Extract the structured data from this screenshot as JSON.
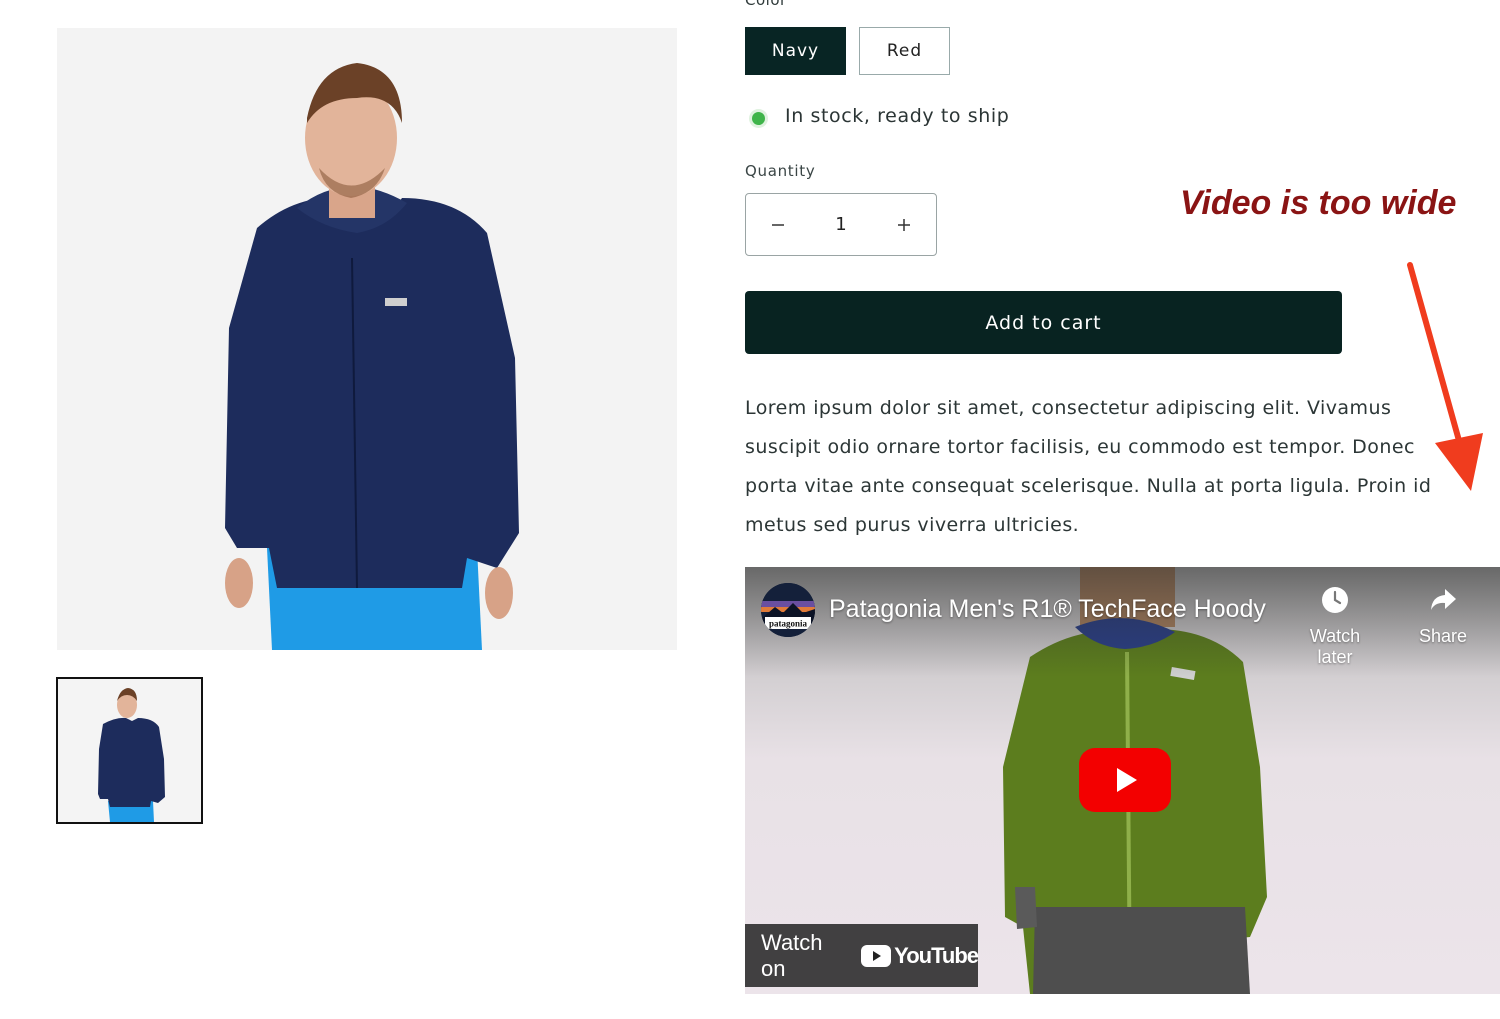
{
  "product": {
    "color_label": "Color",
    "colors": [
      "Navy",
      "Red"
    ],
    "selected_color": "Navy",
    "stock_text": "In stock, ready to ship",
    "quantity_label": "Quantity",
    "quantity": "1",
    "add_to_cart": "Add to cart",
    "description": "Lorem ipsum dolor sit amet, consectetur adipiscing elit. Vivamus suscipit odio ornare tortor facilisis, eu commodo est tempor. Donec porta vitae ante consequat scelerisque. Nulla at porta ligula. Proin id metus sed purus viverra ultricies."
  },
  "annotation": {
    "text": "Video is too wide",
    "color": "#8a1414",
    "arrow_color": "#f03c1e"
  },
  "video": {
    "title": "Patagonia Men's R1® TechFace Hoody",
    "channel_logo_text": "patagonia",
    "watch_later": "Watch later",
    "share": "Share",
    "watch_on": "Watch on",
    "youtube_word": "YouTube"
  },
  "colors": {
    "primary": "#082321",
    "in_stock": "#3fb44a",
    "youtube_red": "#f30000"
  }
}
